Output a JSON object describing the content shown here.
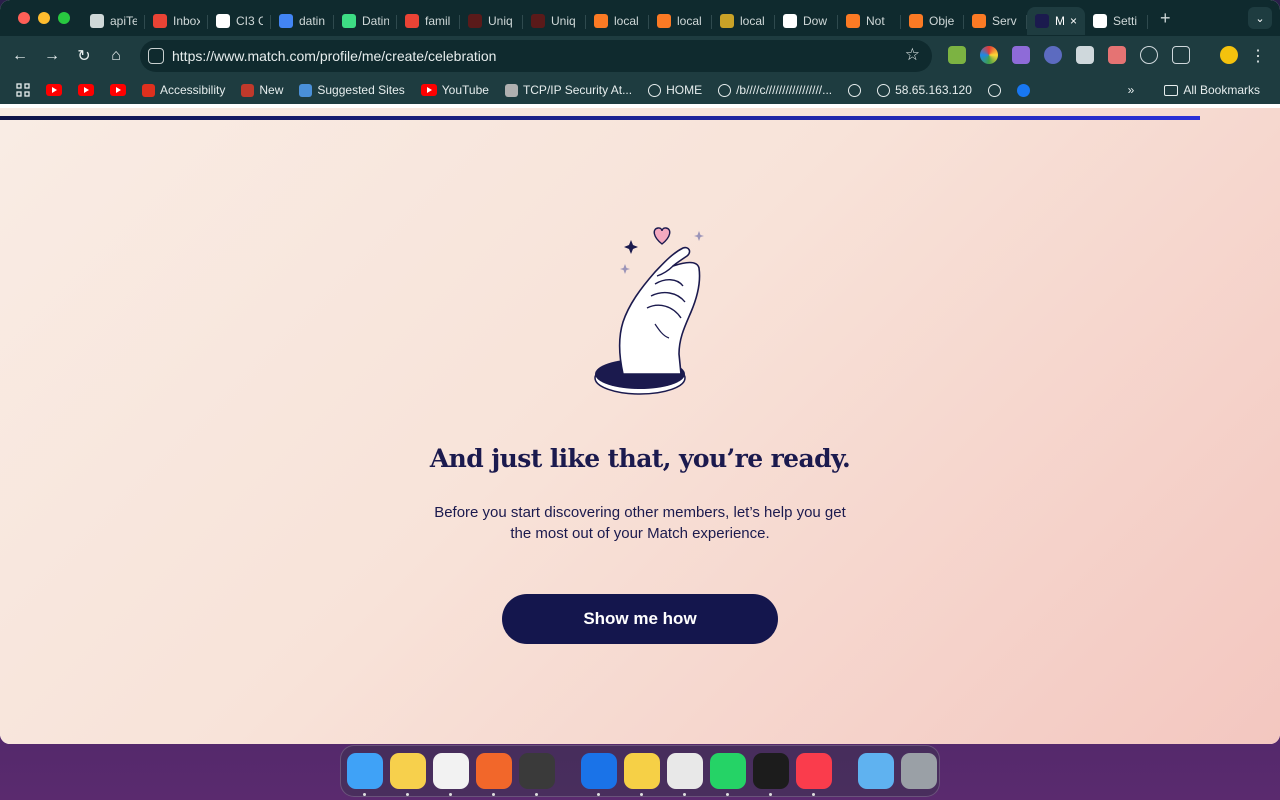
{
  "browser": {
    "tabs": [
      {
        "title": "apiTe",
        "icon": "globe-icon",
        "color": "#cfd8d8"
      },
      {
        "title": "Inbox",
        "icon": "gmail-icon",
        "color": "#ea4335"
      },
      {
        "title": "CI3 C",
        "icon": "openai-icon",
        "color": "#ffffff"
      },
      {
        "title": "datin",
        "icon": "google-icon",
        "color": "#4285f4"
      },
      {
        "title": "Datin",
        "icon": "app-icon",
        "color": "#3ddc84"
      },
      {
        "title": "famil",
        "icon": "gmail-icon",
        "color": "#ea4335"
      },
      {
        "title": "Uniq",
        "icon": "site-icon",
        "color": "#5a1a1a"
      },
      {
        "title": "Uniq",
        "icon": "site-icon",
        "color": "#5a1a1a"
      },
      {
        "title": "local",
        "icon": "xampp-icon",
        "color": "#fb7a24"
      },
      {
        "title": "local",
        "icon": "xampp-icon",
        "color": "#fb7a24"
      },
      {
        "title": "local",
        "icon": "site-icon",
        "color": "#c9a227"
      },
      {
        "title": "Dow",
        "icon": "download-icon",
        "color": "#ffffff"
      },
      {
        "title": "Not",
        "icon": "xampp-icon",
        "color": "#fb7a24"
      },
      {
        "title": "Obje",
        "icon": "xampp-icon",
        "color": "#fb7a24"
      },
      {
        "title": "Serv",
        "icon": "xampp-icon",
        "color": "#fb7a24"
      },
      {
        "title": "M",
        "icon": "match-icon",
        "color": "#1b1a4e",
        "active": true
      },
      {
        "title": "Setti",
        "icon": "gear-icon",
        "color": "#ffffff"
      }
    ],
    "url": "https://www.match.com/profile/me/create/celebration",
    "bookmarks": [
      {
        "label": "",
        "icon": "youtube-icon"
      },
      {
        "label": "",
        "icon": "youtube-icon"
      },
      {
        "label": "",
        "icon": "youtube-icon"
      },
      {
        "label": "Accessibility",
        "icon": "adobe-icon"
      },
      {
        "label": "New",
        "icon": "k-icon"
      },
      {
        "label": "Suggested Sites",
        "icon": "search-icon"
      },
      {
        "label": "YouTube",
        "icon": "youtube-icon"
      },
      {
        "label": "TCP/IP Security At...",
        "icon": "doc-icon"
      },
      {
        "label": "HOME",
        "icon": "globe-icon"
      },
      {
        "label": "/b////c/////////////////...",
        "icon": "globe-icon"
      },
      {
        "label": "",
        "icon": "globe-icon"
      },
      {
        "label": "58.65.163.120",
        "icon": "globe-icon"
      },
      {
        "label": "",
        "icon": "globe-icon"
      },
      {
        "label": "",
        "icon": "facebook-icon"
      }
    ],
    "all_bookmarks_label": "All Bookmarks",
    "more_bookmarks_label": "»"
  },
  "page": {
    "progress": 0.9375,
    "headline": "And just like that, you’re ready.",
    "subtext": "Before you start discovering other members, let’s help you get the most out of your Match experience.",
    "cta_label": "Show me how",
    "colors": {
      "primary": "#14164d",
      "heart": "#f4a9c0",
      "background": "#f8e3d9"
    }
  },
  "dock": {
    "apps": [
      {
        "name": "finder-icon",
        "color": "#3fa2f7",
        "running": true
      },
      {
        "name": "notes-icon",
        "color": "#f7d04c",
        "running": true
      },
      {
        "name": "reminders-icon",
        "color": "#f2f2f2",
        "running": true
      },
      {
        "name": "pencil-app-icon",
        "color": "#f2672a",
        "running": true
      },
      {
        "name": "sublime-text-icon",
        "color": "#3a3a3a",
        "running": true
      },
      {
        "name": "sourcetree-icon",
        "color": "#1a73e8",
        "running": true
      },
      {
        "name": "cyberduck-icon",
        "color": "#f6d046",
        "running": true
      },
      {
        "name": "chrome-icon",
        "color": "#e8e8e8",
        "running": true
      },
      {
        "name": "whatsapp-icon",
        "color": "#25d366",
        "running": true
      },
      {
        "name": "terminal-icon",
        "color": "#1c1c1c",
        "running": true
      },
      {
        "name": "music-icon",
        "color": "#fa3c4c",
        "running": true
      },
      {
        "name": "folder-icon",
        "color": "#5fb2f0",
        "running": false
      },
      {
        "name": "trash-icon",
        "color": "#9aa0a6",
        "running": false
      }
    ]
  }
}
